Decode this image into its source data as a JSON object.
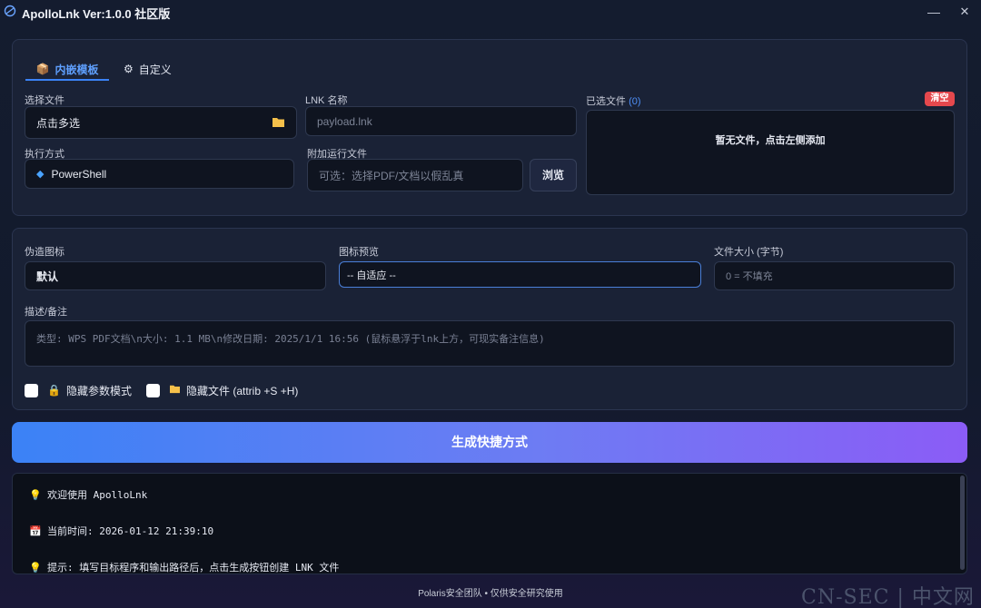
{
  "titlebar": {
    "title": "ApolloLnk Ver:1.0.0 社区版",
    "minimize_glyph": "—",
    "close_glyph": "✕"
  },
  "tabs": [
    {
      "label": "内嵌模板",
      "icon": "package-icon",
      "active": true
    },
    {
      "label": "自定义",
      "icon": "gear-icon",
      "active": false
    }
  ],
  "form": {
    "select_file_label": "选择文件",
    "select_file_value": "点击多选",
    "exec_label": "执行方式",
    "exec_value": "PowerShell",
    "lnk_label": "LNK 名称",
    "lnk_placeholder": "payload.lnk",
    "attach_label": "附加运行文件",
    "attach_placeholder": "可选：选择PDF/文档以假乱真",
    "browse_label": "浏览",
    "selected_label": "已选文件",
    "selected_count": "(0)",
    "clear_label": "清空",
    "empty_text": "暂无文件，点击左侧添加"
  },
  "options": {
    "fake_icon_label": "伪造图标",
    "fake_icon_value": "默认",
    "preview_label": "图标预览",
    "preview_value": "-- 自适应 --",
    "size_label": "文件大小 (字节)",
    "size_placeholder": "0 = 不填充",
    "desc_label": "描述/备注",
    "desc_placeholder": "类型: WPS PDF文档\\n大小: 1.1 MB\\n修改日期: 2025/1/1 16:56 (鼠标悬浮于lnk上方，可现实备注信息)",
    "hide_args_label": "隐藏参数模式",
    "hide_file_label": "隐藏文件 (attrib +S +H)"
  },
  "generate_label": "生成快捷方式",
  "log": [
    {
      "icon": "lightbulb-icon",
      "text": "欢迎使用 ApolloLnk"
    },
    {
      "icon": "calendar-icon",
      "text": "当前时间: 2026-01-12 21:39:10"
    },
    {
      "icon": "lightbulb-icon",
      "text": "提示: 填写目标程序和输出路径后，点击生成按钮创建 LNK 文件"
    }
  ],
  "footer": "Polaris安全团队 • 仅供安全研究使用",
  "watermark": "CN-SEC | 中文网",
  "colors": {
    "accent": "#3b82f6",
    "accent_end": "#8b5cf6",
    "danger": "#e5484d",
    "panel": "#1a2236"
  }
}
